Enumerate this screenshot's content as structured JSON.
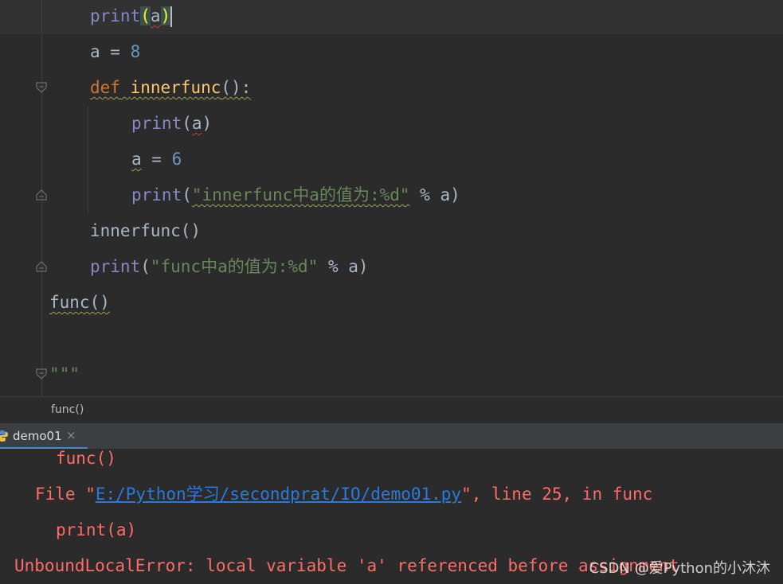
{
  "editor": {
    "line1": {
      "fn": "print",
      "open": "(",
      "arg": "a",
      "close": ")"
    },
    "line2": {
      "var": "a",
      "op": " = ",
      "num": "8"
    },
    "line3": {
      "kw": "def",
      "name": "innerfunc",
      "rest": "():"
    },
    "line4": {
      "fn": "print",
      "open": "(",
      "arg": "a",
      "close": ")"
    },
    "line5": {
      "var": "a",
      "op": " = ",
      "num": "6"
    },
    "line6": {
      "fn": "print",
      "open": "(",
      "str": "\"innerfunc中a的值为:%d\"",
      "rest": " % a)"
    },
    "line7": {
      "text": "innerfunc()"
    },
    "line8": {
      "fn": "print",
      "open": "(",
      "str": "\"func中a的值为:%d\"",
      "rest": " % a)"
    },
    "line9": {
      "text": "func()"
    },
    "line10": {
      "text": "\"\"\""
    }
  },
  "breadcrumb": {
    "label": "func()"
  },
  "run_panel": {
    "tab_label": "demo01",
    "close_glyph": "×"
  },
  "console": {
    "line1": "func()",
    "line2_pre": "File \"",
    "line2_link": "E:/Python学习/secondprat/IO/demo01.py",
    "line2_post": "\", line 25, in func",
    "line3": "print(a)",
    "line4": "UnboundLocalError: local variable 'a' referenced before assignment"
  },
  "watermark": "CSDN @爱Python的小沐沐",
  "colors": {
    "background": "#2b2b2b",
    "keyword": "#cc7832",
    "builtin": "#8888c6",
    "function_def": "#ffc66d",
    "number": "#6897bb",
    "string": "#6a8759",
    "error_text": "#ff6b68",
    "link": "#287bde"
  }
}
